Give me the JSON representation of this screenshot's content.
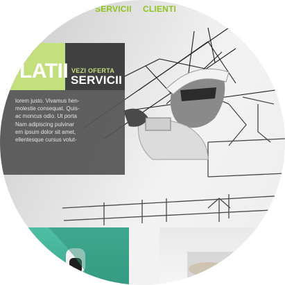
{
  "nav": {
    "items": [
      "SERVICII",
      "CLIENTI"
    ]
  },
  "hero": {
    "title": "LATII",
    "cta": {
      "small_label": "VEZI OFERTA",
      "main_label": "SERVICII"
    },
    "body_lines": [
      "lorem justo. Vivamus hen-",
      "molestie consequat. Quis-",
      "ac moncus odio. Ut porta",
      "Nam adipiscing pulvinar",
      "em ipsum dolor sit amet,",
      "ellentesque cursus volut-"
    ]
  },
  "colors": {
    "accent": "#8fc31f",
    "lime_block": "#c4df7d",
    "panel_dark": "#404040",
    "thumb_teal": "#4fbfa4"
  }
}
